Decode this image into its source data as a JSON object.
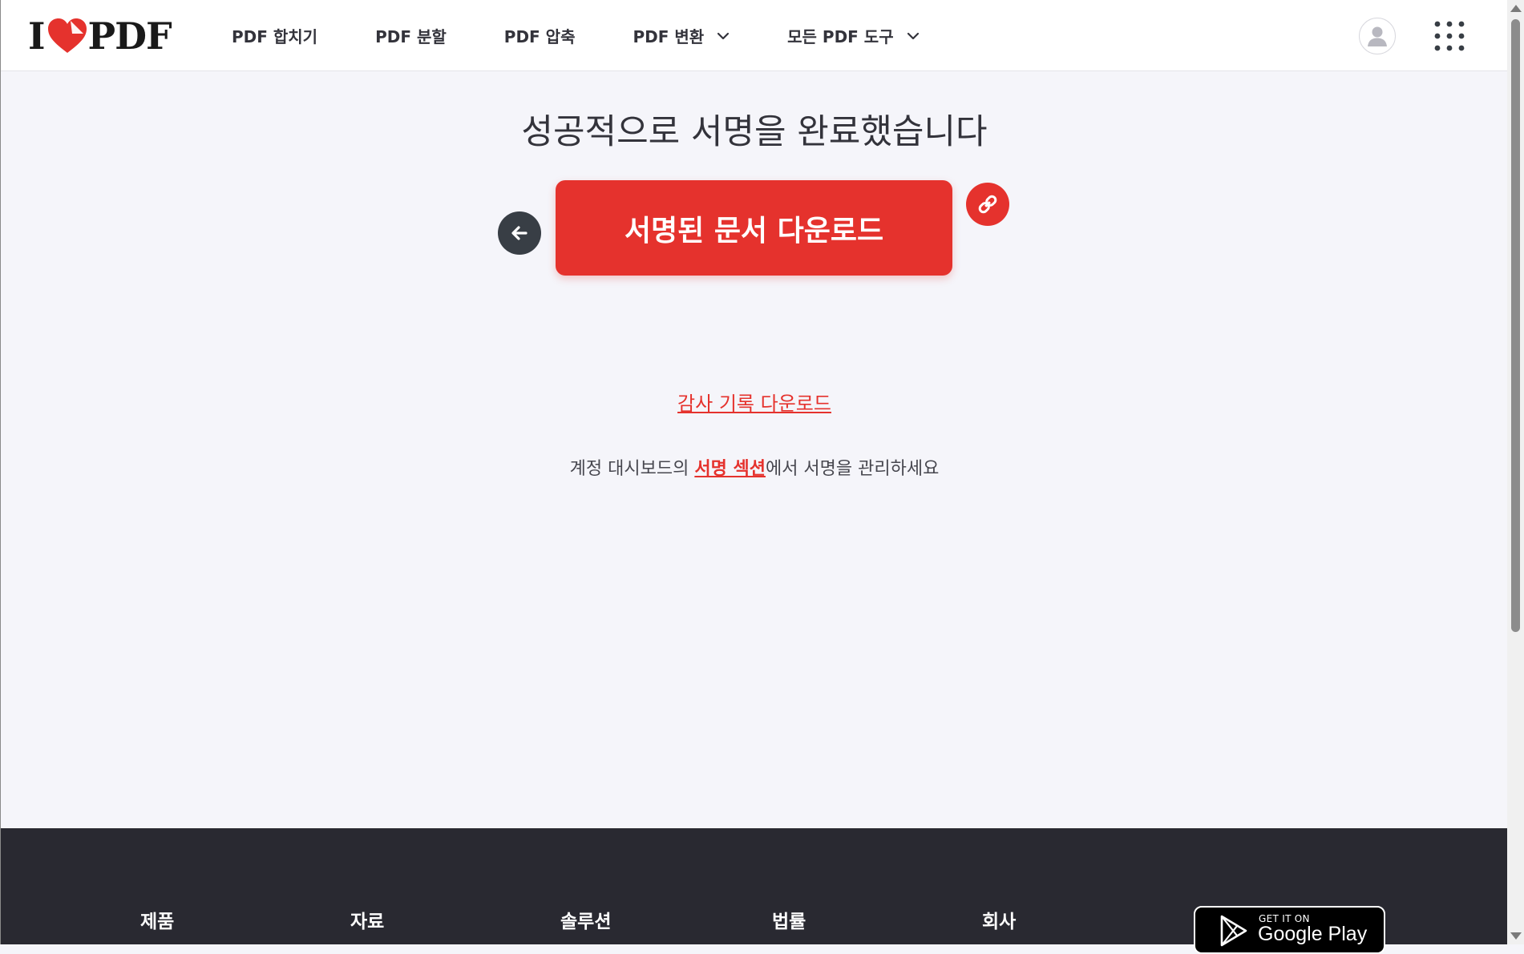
{
  "header": {
    "logo": {
      "prefix": "I",
      "suffix": "PDF"
    },
    "nav": [
      {
        "label": "PDF 합치기",
        "has_dropdown": false
      },
      {
        "label": "PDF 분할",
        "has_dropdown": false
      },
      {
        "label": "PDF 압축",
        "has_dropdown": false
      },
      {
        "label": "PDF 변환",
        "has_dropdown": true
      },
      {
        "label": "모든 PDF 도구",
        "has_dropdown": true
      }
    ]
  },
  "main": {
    "title": "성공적으로 서명을 완료했습니다",
    "download_label": "서명된 문서 다운로드",
    "audit_label": "감사 기록 다운로드",
    "manage_prefix": "계정 대시보드의 ",
    "manage_link": "서명 섹션",
    "manage_suffix": "에서 서명을 관리하세요"
  },
  "footer": {
    "columns": [
      "제품",
      "자료",
      "솔루션",
      "법률",
      "회사"
    ],
    "store": {
      "get_it_on": "GET IT ON",
      "store_name": "Google Play"
    }
  },
  "colors": {
    "brand": "#e5322d",
    "dark_button": "#383e45",
    "footer_bg": "#292931",
    "page_bg": "#f5f5fa"
  },
  "icons": [
    "heart-logo-icon",
    "chevron-down-icon",
    "user-avatar-icon",
    "apps-grid-icon",
    "arrow-left-icon",
    "link-icon",
    "google-play-icon"
  ]
}
